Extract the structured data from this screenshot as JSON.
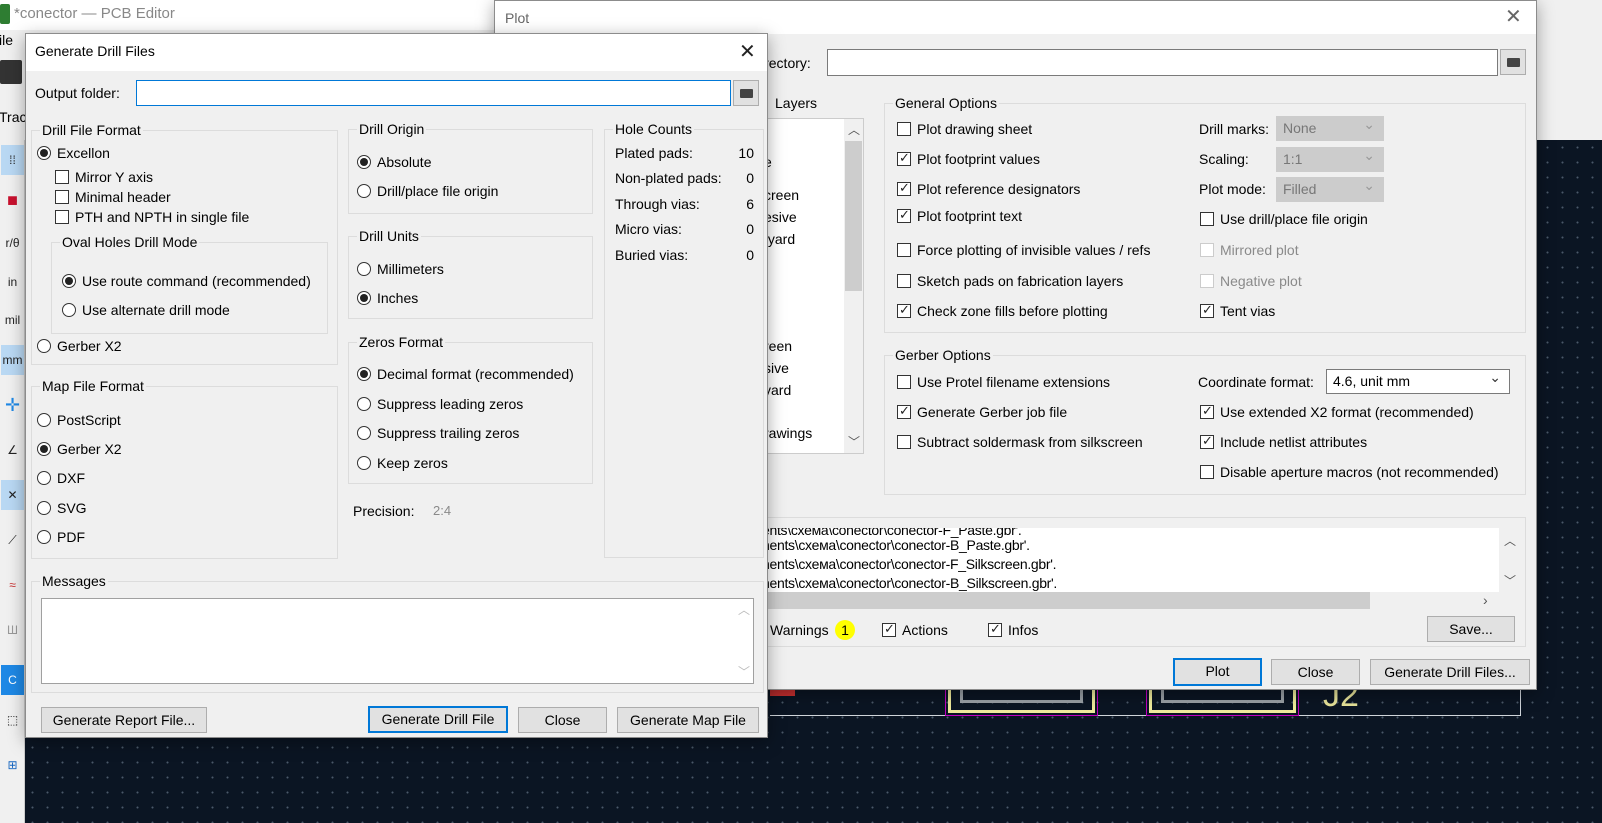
{
  "pcb_editor": {
    "title": "*conector — PCB Editor",
    "menu_fragment": "ile",
    "toolbar_fragment": "Trac",
    "unit_buttons": [
      "in",
      "mil",
      "mm"
    ],
    "footprint_ref": "J2"
  },
  "drill_dialog": {
    "title": "Generate Drill Files",
    "output_folder_label": "Output folder:",
    "output_folder_value": "",
    "file_format": {
      "title": "Drill File Format",
      "excellon": {
        "label": "Excellon",
        "selected": true
      },
      "mirror_y": {
        "label": "Mirror Y axis",
        "checked": false
      },
      "minimal_header": {
        "label": "Minimal header",
        "checked": false
      },
      "pth_npth_single": {
        "label": "PTH and NPTH in single file",
        "checked": false
      },
      "oval_holes": {
        "title": "Oval Holes Drill Mode",
        "route": {
          "label": "Use route command (recommended)",
          "selected": true
        },
        "alternate": {
          "label": "Use alternate drill mode",
          "selected": false
        }
      },
      "gerber_x2": {
        "label": "Gerber X2",
        "selected": false
      }
    },
    "map_format": {
      "title": "Map File Format",
      "options": [
        {
          "label": "PostScript",
          "selected": false
        },
        {
          "label": "Gerber X2",
          "selected": true
        },
        {
          "label": "DXF",
          "selected": false
        },
        {
          "label": "SVG",
          "selected": false
        },
        {
          "label": "PDF",
          "selected": false
        }
      ]
    },
    "drill_origin": {
      "title": "Drill Origin",
      "options": [
        {
          "label": "Absolute",
          "selected": true
        },
        {
          "label": "Drill/place file origin",
          "selected": false
        }
      ]
    },
    "drill_units": {
      "title": "Drill Units",
      "options": [
        {
          "label": "Millimeters",
          "selected": false
        },
        {
          "label": "Inches",
          "selected": true
        }
      ]
    },
    "zeros_format": {
      "title": "Zeros Format",
      "options": [
        {
          "label": "Decimal format (recommended)",
          "selected": true
        },
        {
          "label": "Suppress leading zeros",
          "selected": false
        },
        {
          "label": "Suppress trailing zeros",
          "selected": false
        },
        {
          "label": "Keep zeros",
          "selected": false
        }
      ]
    },
    "precision_label": "Precision:",
    "precision_value": "2:4",
    "hole_counts": {
      "title": "Hole Counts",
      "rows": [
        {
          "label": "Plated pads:",
          "value": "10"
        },
        {
          "label": "Non-plated pads:",
          "value": "0"
        },
        {
          "label": "Through vias:",
          "value": "6"
        },
        {
          "label": "Micro vias:",
          "value": "0"
        },
        {
          "label": "Buried vias:",
          "value": "0"
        }
      ]
    },
    "messages_title": "Messages",
    "buttons": {
      "report": "Generate Report File...",
      "drill": "Generate Drill File",
      "close": "Close",
      "map": "Generate Map File"
    }
  },
  "plot_dialog": {
    "title": "Plot",
    "output_dir_label_fragment": "irectory:",
    "output_dir_value": "",
    "layers_title_fragment": "Layers",
    "layer_fragments": [
      "t",
      "e",
      "creen",
      "esive",
      "tyard",
      "",
      "",
      "",
      "",
      "reen",
      "sive",
      "yard",
      "",
      "rawings"
    ],
    "general": {
      "title": "General Options",
      "left": [
        {
          "label": "Plot drawing sheet",
          "checked": false
        },
        {
          "label": "Plot footprint values",
          "checked": true
        },
        {
          "label": "Plot reference designators",
          "checked": true
        },
        {
          "label": "Plot footprint text",
          "checked": true
        },
        {
          "label": "Force plotting of invisible values / refs",
          "checked": false
        },
        {
          "label": "Sketch pads on fabrication layers",
          "checked": false
        },
        {
          "label": "Check zone fills before plotting",
          "checked": true
        }
      ],
      "drill_marks": {
        "label": "Drill marks:",
        "value": "None"
      },
      "scaling": {
        "label": "Scaling:",
        "value": "1:1"
      },
      "plot_mode": {
        "label": "Plot mode:",
        "value": "Filled"
      },
      "right": [
        {
          "label": "Use drill/place file origin",
          "checked": false,
          "disabled": false
        },
        {
          "label": "Mirrored plot",
          "checked": false,
          "disabled": true
        },
        {
          "label": "Negative plot",
          "checked": false,
          "disabled": true
        },
        {
          "label": "Tent vias",
          "checked": true,
          "disabled": false
        }
      ]
    },
    "gerber": {
      "title": "Gerber Options",
      "left": [
        {
          "label": "Use Protel filename extensions",
          "checked": false
        },
        {
          "label": "Generate Gerber job file",
          "checked": true
        },
        {
          "label": "Subtract soldermask from silkscreen",
          "checked": false
        }
      ],
      "coord_format": {
        "label": "Coordinate format:",
        "value": "4.6, unit mm"
      },
      "right": [
        {
          "label": "Use extended X2 format (recommended)",
          "checked": true
        },
        {
          "label": "Include netlist attributes",
          "checked": true
        },
        {
          "label": "Disable aperture macros (not recommended)",
          "checked": false
        }
      ]
    },
    "messages": {
      "lines": [
        "ents\\схема\\conector\\conector-F_Paste.gbr'.",
        "nents\\схема\\conector\\conector-B_Paste.gbr'.",
        "nents\\схема\\conector\\conector-F_Silkscreen.gbr'.",
        "nents\\схема\\conector\\conector-B_Silkscreen.gbr'."
      ],
      "warnings_fragment": "Warnings",
      "warnings_count": "1",
      "actions": {
        "label": "Actions",
        "checked": true
      },
      "infos": {
        "label": "Infos",
        "checked": true
      },
      "save": "Save..."
    },
    "buttons": {
      "plot": "Plot",
      "close": "Close",
      "drill": "Generate Drill Files..."
    }
  },
  "colors": {
    "canvas": "#0b1523",
    "pad_outline": "#f0ec9c",
    "courtyard": "#c000c0",
    "accent": "#0078d7",
    "badge": "#ffff00"
  }
}
